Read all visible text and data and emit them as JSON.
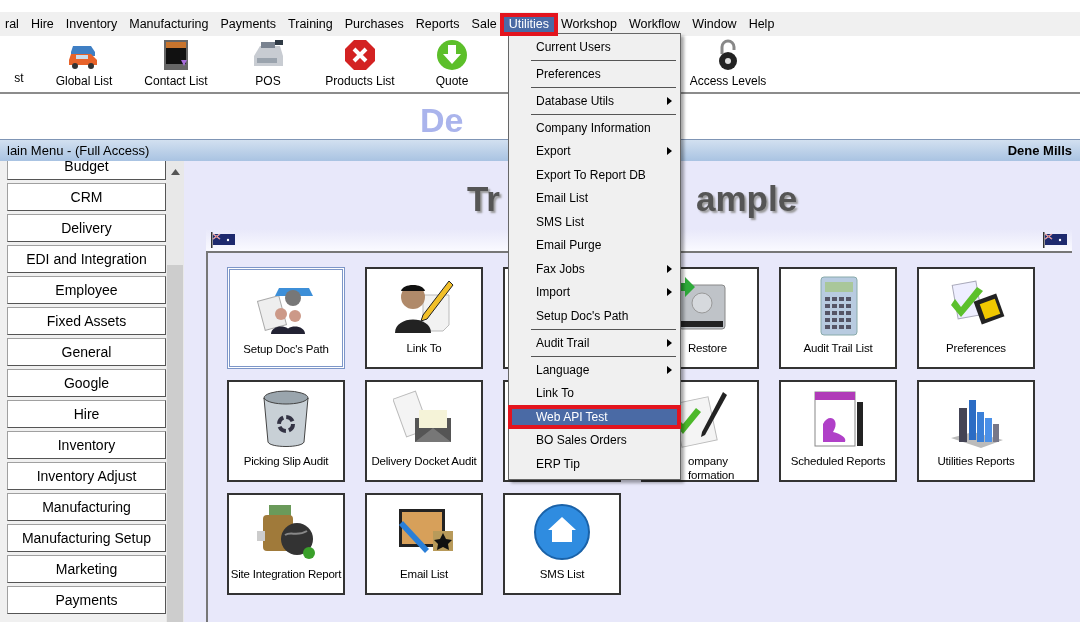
{
  "menubar": [
    {
      "label": "ral",
      "selected": false,
      "highlighted": false
    },
    {
      "label": "Hire",
      "selected": false,
      "highlighted": false
    },
    {
      "label": "Inventory",
      "selected": false,
      "highlighted": false
    },
    {
      "label": "Manufacturing",
      "selected": false,
      "highlighted": false
    },
    {
      "label": "Payments",
      "selected": false,
      "highlighted": false
    },
    {
      "label": "Training",
      "selected": false,
      "highlighted": false
    },
    {
      "label": "Purchases",
      "selected": false,
      "highlighted": false
    },
    {
      "label": "Reports",
      "selected": false,
      "highlighted": false
    },
    {
      "label": "Sale",
      "selected": false,
      "highlighted": false
    },
    {
      "label": "Utilities",
      "selected": true,
      "highlighted": true
    },
    {
      "label": "Workshop",
      "selected": false,
      "highlighted": false
    },
    {
      "label": "Workflow",
      "selected": false,
      "highlighted": false
    },
    {
      "label": "Window",
      "selected": false,
      "highlighted": false
    },
    {
      "label": "Help",
      "selected": false,
      "highlighted": false
    }
  ],
  "toolbar": [
    {
      "label": "st"
    },
    {
      "label": "Global List"
    },
    {
      "label": "Contact List"
    },
    {
      "label": "POS"
    },
    {
      "label": "Products List"
    },
    {
      "label": "Quote"
    },
    {
      "label": "Access Levels"
    }
  ],
  "logo_text": "De",
  "title_bar": {
    "title": "lain Menu - (Full Access)",
    "user": "Dene Mills"
  },
  "sidebar": [
    {
      "label": "Budget"
    },
    {
      "label": "CRM"
    },
    {
      "label": "Delivery"
    },
    {
      "label": "EDI and Integration"
    },
    {
      "label": "Employee"
    },
    {
      "label": "Fixed Assets"
    },
    {
      "label": "General"
    },
    {
      "label": "Google"
    },
    {
      "label": "Hire"
    },
    {
      "label": "Inventory"
    },
    {
      "label": "Inventory Adjust"
    },
    {
      "label": "Manufacturing"
    },
    {
      "label": "Manufacturing Setup"
    },
    {
      "label": "Marketing"
    },
    {
      "label": "Payments"
    }
  ],
  "main": {
    "title_parts": [
      "Tr",
      "ample"
    ],
    "tiles": [
      {
        "label": "Setup Doc's Path",
        "selected": true
      },
      {
        "label": "Link To",
        "selected": false
      },
      {
        "selected": false
      },
      {
        "label": "Restore",
        "selected": false
      },
      {
        "label": "Audit Trail List",
        "selected": false
      },
      {
        "label": "Preferences",
        "selected": false
      },
      {
        "label": "Picking Slip Audit",
        "selected": false
      },
      {
        "label": "Delivery Docket Audit",
        "selected": false
      },
      {
        "selected": false
      },
      {
        "label": "ompany formation",
        "selected": false
      },
      {
        "label": "Scheduled Reports",
        "selected": false
      },
      {
        "label": "Utilities Reports",
        "selected": false
      },
      {
        "label": "Site Integration Report",
        "selected": false
      },
      {
        "label": "Email List",
        "selected": false
      },
      {
        "label": "SMS List",
        "selected": false
      }
    ]
  },
  "utilities_menu": [
    {
      "kind": "item",
      "label": "Current Users",
      "submenu": false,
      "selected": false,
      "highlighted": false
    },
    {
      "kind": "separator"
    },
    {
      "kind": "item",
      "label": "Preferences",
      "submenu": false,
      "selected": false,
      "highlighted": false
    },
    {
      "kind": "separator"
    },
    {
      "kind": "item",
      "label": "Database Utils",
      "submenu": true,
      "selected": false,
      "highlighted": false
    },
    {
      "kind": "separator"
    },
    {
      "kind": "item",
      "label": "Company Information",
      "submenu": false,
      "selected": false,
      "highlighted": false
    },
    {
      "kind": "item",
      "label": "Export",
      "submenu": true,
      "selected": false,
      "highlighted": false
    },
    {
      "kind": "item",
      "label": "Export To Report DB",
      "submenu": false,
      "selected": false,
      "highlighted": false
    },
    {
      "kind": "item",
      "label": "Email List",
      "submenu": false,
      "selected": false,
      "highlighted": false
    },
    {
      "kind": "item",
      "label": "SMS List",
      "submenu": false,
      "selected": false,
      "highlighted": false
    },
    {
      "kind": "item",
      "label": "Email Purge",
      "submenu": false,
      "selected": false,
      "highlighted": false
    },
    {
      "kind": "item",
      "label": "Fax Jobs",
      "submenu": true,
      "selected": false,
      "highlighted": false
    },
    {
      "kind": "item",
      "label": "Import",
      "submenu": true,
      "selected": false,
      "highlighted": false
    },
    {
      "kind": "item",
      "label": "Setup  Doc's Path",
      "submenu": false,
      "selected": false,
      "highlighted": false
    },
    {
      "kind": "separator"
    },
    {
      "kind": "item",
      "label": "Audit Trail",
      "submenu": true,
      "selected": false,
      "highlighted": false
    },
    {
      "kind": "separator"
    },
    {
      "kind": "item",
      "label": "Language",
      "submenu": true,
      "selected": false,
      "highlighted": false
    },
    {
      "kind": "item",
      "label": "Link To",
      "submenu": false,
      "selected": false,
      "highlighted": false
    },
    {
      "kind": "item",
      "label": "Web API Test",
      "submenu": false,
      "selected": true,
      "highlighted": true
    },
    {
      "kind": "item",
      "label": "BO Sales Orders",
      "submenu": false,
      "selected": false,
      "highlighted": false
    },
    {
      "kind": "item",
      "label": "ERP Tip",
      "submenu": false,
      "selected": false,
      "highlighted": false
    }
  ]
}
